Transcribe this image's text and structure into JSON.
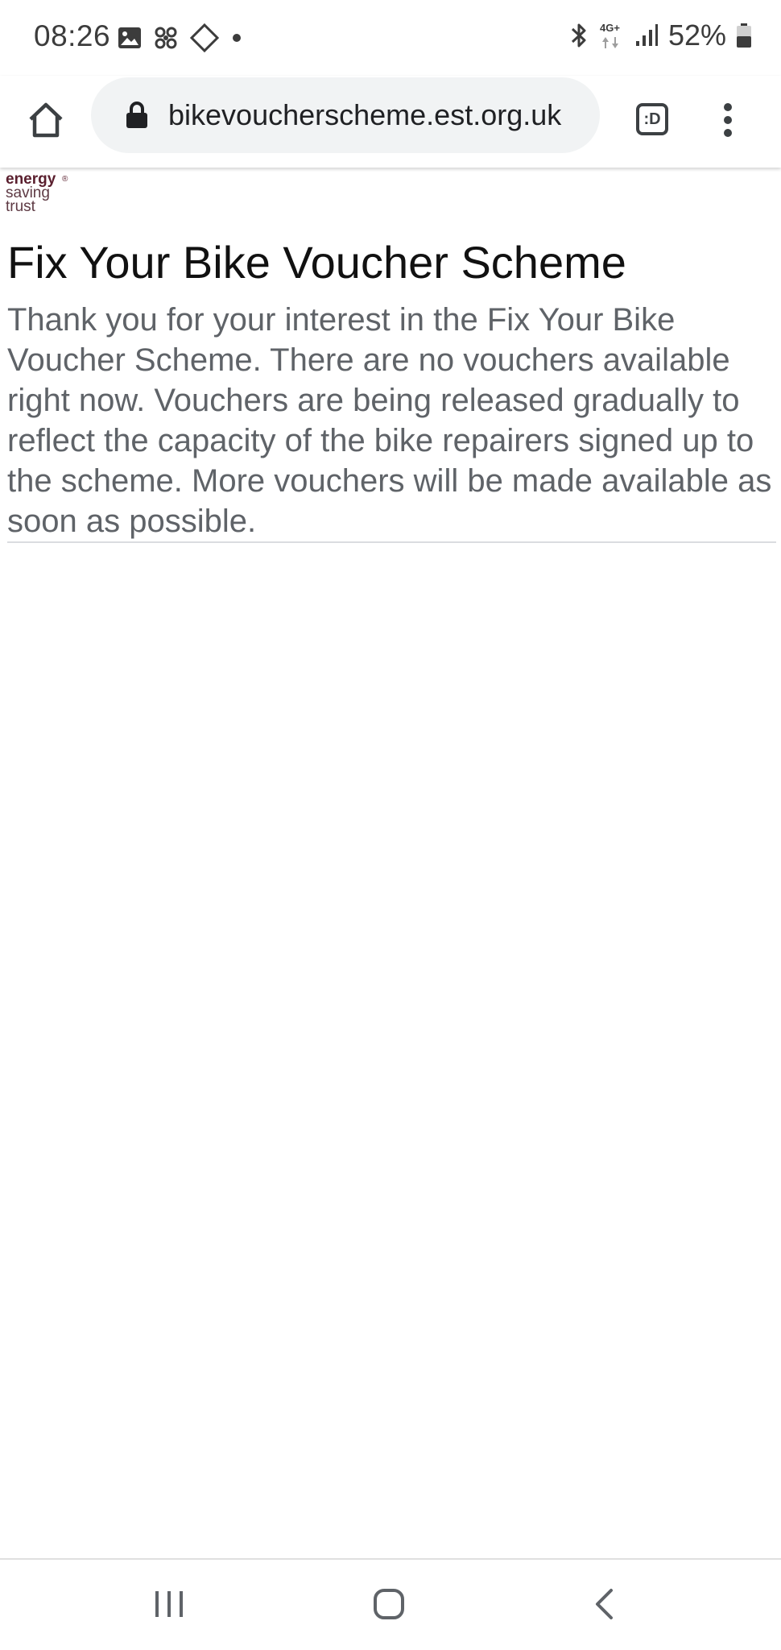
{
  "status_bar": {
    "time": "08:26",
    "battery_percent": "52%",
    "network_label": "4G+",
    "left_icons": [
      "image-icon",
      "fan-icon",
      "move-icon",
      "dot-icon"
    ],
    "right_icons": [
      "bluetooth-icon",
      "network-4g-icon",
      "signal-icon",
      "battery-icon"
    ]
  },
  "browser": {
    "url": "bikevoucherscheme.est.org.uk",
    "tab_switcher_label": ":D",
    "icons": [
      "home-icon",
      "lock-icon",
      "tab-switcher-icon",
      "more-vert-icon"
    ]
  },
  "page": {
    "logo": {
      "line1": "energy",
      "line2": "saving",
      "line3": "trust",
      "registered": "®"
    },
    "title": "Fix Your Bike Voucher Scheme",
    "message": "Thank you for your interest in the Fix Your Bike Voucher Scheme. There are no vouchers available right now. Vouchers are being released gradually to reflect the capacity of the bike repairers signed up to the scheme. More vouchers will be made available as soon as possible."
  },
  "nav_bar": {
    "icons": [
      "recents-icon",
      "home-nav-icon",
      "back-icon"
    ]
  },
  "colors": {
    "logo_brand": "#5a1f2e",
    "omnibox_bg": "#f1f3f4",
    "message_text": "#5f6368",
    "title_text": "#111111"
  }
}
